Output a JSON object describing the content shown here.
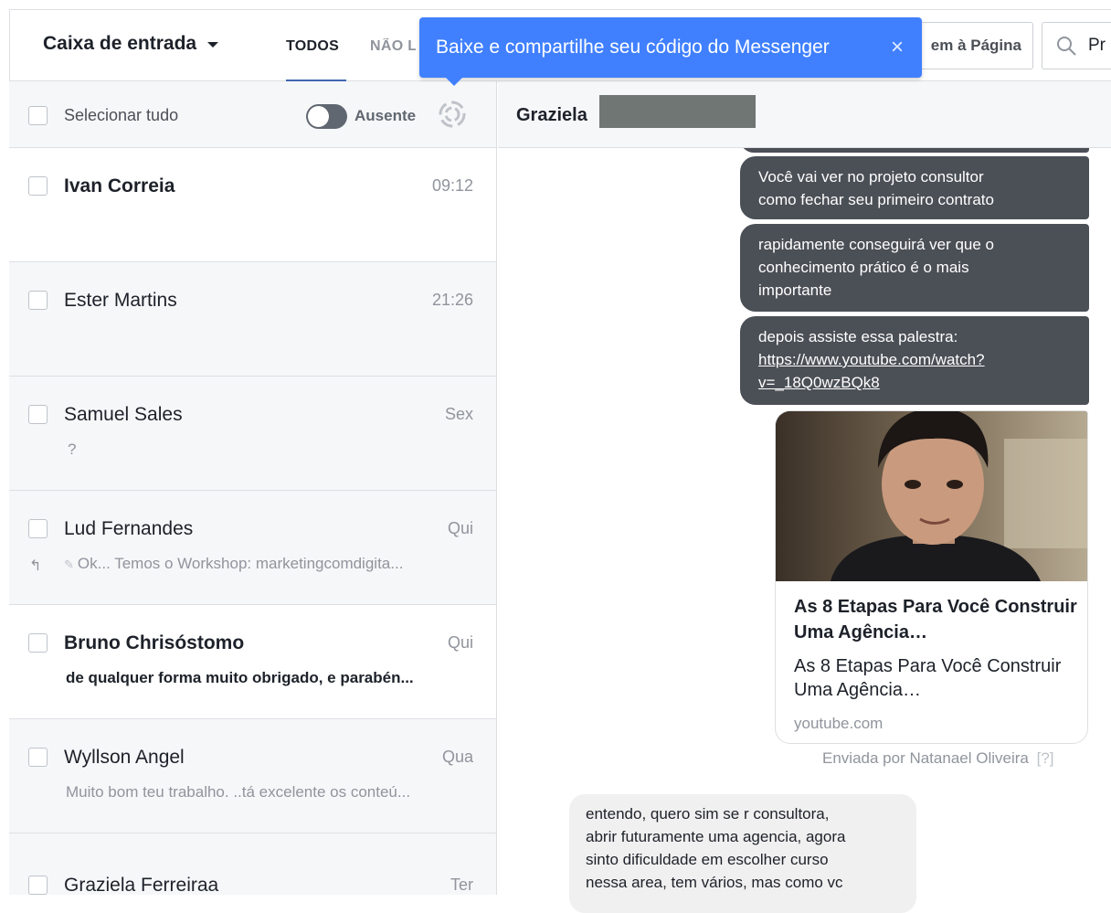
{
  "topbar": {
    "inbox_title": "Caixa de entrada",
    "tab_all": "TODOS",
    "tab_unread": "NÃO LIDAS",
    "page_button": "em à Página",
    "search_text": "Pr"
  },
  "tooltip": {
    "text": "Baixe e compartilhe seu código do Messenger",
    "close": "×"
  },
  "select_bar": {
    "select_all": "Selecionar tudo",
    "away": "Ausente"
  },
  "conversations": [
    {
      "name": "Ivan Correia",
      "time": "09:12",
      "snippet": ""
    },
    {
      "name": "Ester Martins",
      "time": "21:26",
      "snippet": ""
    },
    {
      "name": "Samuel Sales",
      "time": "Sex",
      "snippet": "?"
    },
    {
      "name": "Lud Fernandes",
      "time": "Qui",
      "snippet": "Ok... Temos o Workshop: marketingcomdigita..."
    },
    {
      "name": "Bruno Chrisóstomo",
      "time": "Qui",
      "snippet": "de qualquer forma muito obrigado, e parabén..."
    },
    {
      "name": "Wyllson Angel",
      "time": "Qua",
      "snippet": "Muito bom teu trabalho. ..tá excelente os conteú..."
    },
    {
      "name": "Graziela Ferreiraa",
      "time": "Ter",
      "snippet": ""
    }
  ],
  "chat": {
    "contact_name": "Graziela",
    "messages": [
      {
        "line1": "Você vai ver no projeto consultor",
        "line2": "como fechar seu primeiro contrato"
      },
      {
        "line1": "rapidamente conseguirá ver que o",
        "line2": "conhecimento prático é o mais",
        "line3": "importante"
      },
      {
        "line1": "depois assiste essa palestra:",
        "link1": "https://www.youtube.com/watch?",
        "link2": "v=_18Q0wzBQk8"
      }
    ],
    "card": {
      "title": "As 8 Etapas Para Você Construir Uma Agência…",
      "description": "As 8 Etapas Para Você Construir Uma Agência…",
      "domain": "youtube.com"
    },
    "sent_by": "Enviada por Natanael Oliveira",
    "sent_by_help": "[?]",
    "reply": {
      "line1": "entendo, quero sim se r consultora,",
      "line2": "abrir futuramente uma agencia, agora",
      "line3": "sinto dificuldade em escolher curso",
      "line4": "nessa area, tem vários, mas como vc"
    }
  },
  "colors": {
    "accent": "#4080ff",
    "tab_underline": "#4267b2",
    "sent_bubble": "#4b4f56",
    "received_bubble": "#f1f0f0"
  }
}
